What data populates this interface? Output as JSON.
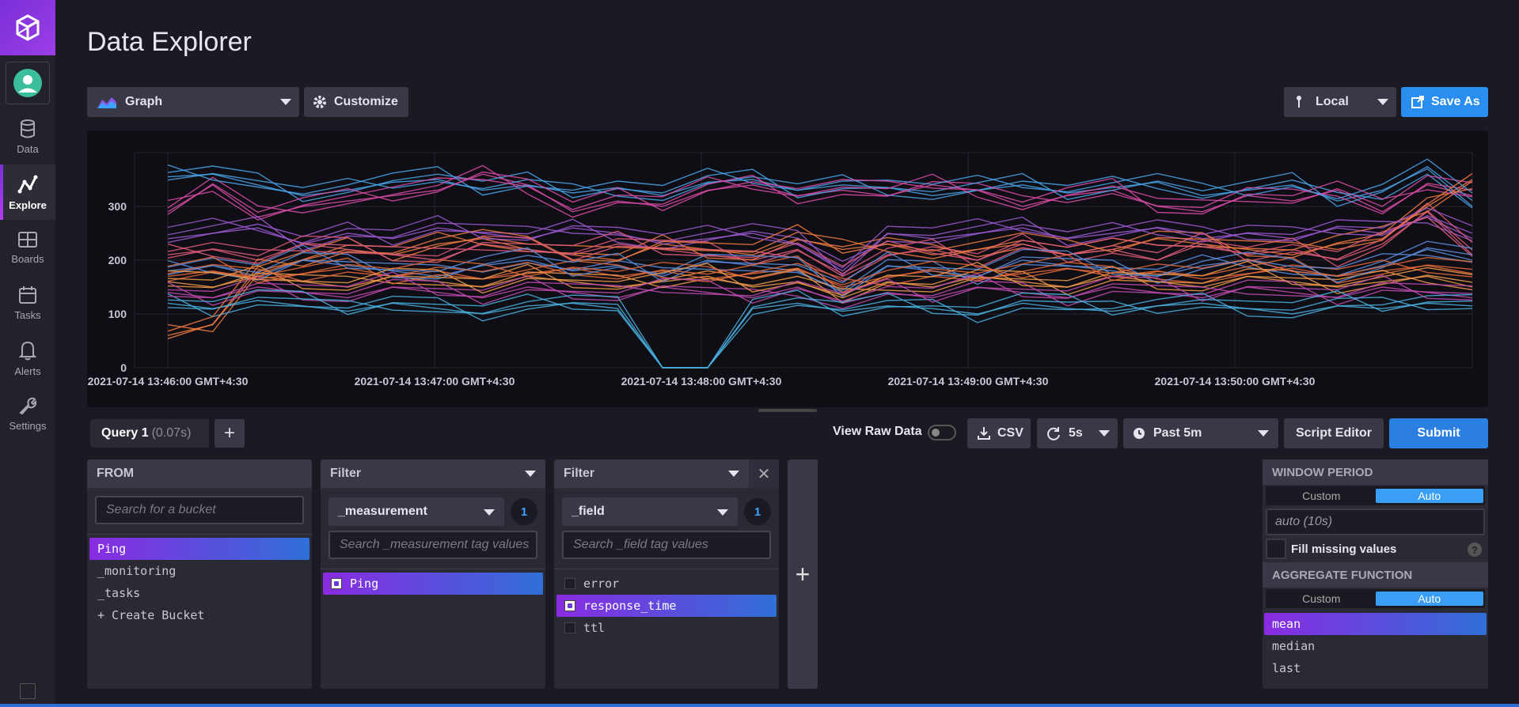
{
  "app": {
    "title": "Data Explorer"
  },
  "sidebar": {
    "items": [
      {
        "label": "Data",
        "icon": "database-icon",
        "active": false
      },
      {
        "label": "Explore",
        "icon": "explore-icon",
        "active": true
      },
      {
        "label": "Boards",
        "icon": "boards-icon",
        "active": false
      },
      {
        "label": "Tasks",
        "icon": "calendar-icon",
        "active": false
      },
      {
        "label": "Alerts",
        "icon": "bell-icon",
        "active": false
      },
      {
        "label": "Settings",
        "icon": "wrench-icon",
        "active": false
      }
    ]
  },
  "toolbar": {
    "graph_type": "Graph",
    "customize_label": "Customize",
    "timezone": "Local",
    "save_as_label": "Save As"
  },
  "colors": {
    "accent_blue": "#2a8ef0",
    "accent_purple": "#8a2be2",
    "line_blue": "#4aa3e8",
    "line_pink": "#d94ba6",
    "line_orange": "#f07a40"
  },
  "chart_data": {
    "type": "line",
    "title": "",
    "xlabel": "",
    "ylabel": "",
    "ylim": [
      0,
      400
    ],
    "y_ticks": [
      "0",
      "100",
      "200",
      "300"
    ],
    "x_ticks": [
      "2021-07-14 13:46:00 GMT+4:30",
      "2021-07-14 13:47:00 GMT+4:30",
      "2021-07-14 13:48:00 GMT+4:30",
      "2021-07-14 13:49:00 GMT+4:30",
      "2021-07-14 13:50:00 GMT+4:30"
    ],
    "grid": true,
    "legend": "none",
    "series_count_estimate": 40,
    "value_range_note_series": [
      {
        "values": [
          355,
          360,
          340,
          320,
          330,
          345,
          350,
          330,
          340,
          325,
          335,
          320,
          345,
          350,
          330,
          340,
          335,
          320,
          330,
          340,
          325,
          335,
          345,
          320,
          330,
          340,
          310,
          330,
          370,
          300
        ]
      },
      {
        "values": [
          290,
          340,
          280,
          300,
          310,
          320,
          330,
          360,
          340,
          290,
          310,
          300,
          330,
          340,
          320,
          330,
          320,
          340,
          330,
          300,
          320,
          330,
          300,
          290,
          320,
          310,
          330,
          290,
          340,
          320
        ]
      },
      {
        "values": [
          60,
          80,
          180,
          200,
          220,
          210,
          230,
          240,
          220,
          210,
          200,
          230,
          220,
          210,
          240,
          220,
          230,
          210,
          220,
          230,
          210,
          220,
          240,
          230,
          220,
          210,
          230,
          240,
          300,
          350
        ]
      },
      {
        "values": [
          240,
          250,
          260,
          230,
          250,
          240,
          260,
          250,
          240,
          260,
          250,
          230,
          240,
          250,
          230,
          180,
          250,
          240,
          250,
          260,
          240,
          250,
          260,
          240,
          250,
          240,
          260,
          250,
          280,
          240
        ]
      },
      {
        "values": [
          210,
          220,
          200,
          230,
          220,
          210,
          200,
          230,
          220,
          210,
          230,
          220,
          210,
          200,
          220,
          170,
          210,
          220,
          200,
          230,
          210,
          220,
          200,
          230,
          210,
          220,
          200,
          230,
          290,
          210
        ]
      },
      {
        "values": [
          180,
          190,
          170,
          200,
          190,
          180,
          170,
          190,
          200,
          180,
          190,
          170,
          200,
          190,
          180,
          140,
          190,
          180,
          170,
          200,
          190,
          180,
          170,
          190,
          200,
          180,
          170,
          190,
          220,
          200
        ]
      },
      {
        "values": [
          160,
          150,
          170,
          160,
          150,
          170,
          160,
          150,
          170,
          160,
          150,
          160,
          170,
          150,
          160,
          130,
          160,
          150,
          170,
          160,
          150,
          170,
          160,
          150,
          170,
          160,
          150,
          160,
          170,
          150
        ]
      },
      {
        "values": [
          140,
          130,
          150,
          140,
          130,
          150,
          140,
          130,
          150,
          140,
          130,
          150,
          140,
          130,
          150,
          120,
          140,
          130,
          150,
          140,
          130,
          150,
          140,
          130,
          150,
          140,
          130,
          150,
          140,
          130
        ]
      },
      {
        "values": [
          120,
          110,
          125,
          115,
          105,
          120,
          110,
          100,
          115,
          120,
          110,
          0,
          0,
          110,
          120,
          105,
          115,
          110,
          100,
          120,
          110,
          105,
          115,
          120,
          110,
          100,
          115,
          110,
          120,
          115
        ]
      },
      {
        "values": [
          170,
          180,
          165,
          175,
          185,
          170,
          180,
          165,
          175,
          185,
          170,
          180,
          165,
          175,
          185,
          150,
          170,
          180,
          165,
          175,
          185,
          170,
          180,
          165,
          175,
          185,
          170,
          180,
          190,
          175
        ]
      }
    ]
  },
  "query": {
    "tab_label": "Query 1",
    "tab_time": "(0.07s)",
    "view_raw_label": "View Raw Data",
    "csv_label": "CSV",
    "refresh_label": "5s",
    "range_label": "Past 5m",
    "script_editor_label": "Script Editor",
    "submit_label": "Submit"
  },
  "builder": {
    "from": {
      "header": "FROM",
      "search_placeholder": "Search for a bucket",
      "items": [
        "Ping",
        "_monitoring",
        "_tasks",
        "+ Create Bucket"
      ],
      "selected": "Ping"
    },
    "filter1": {
      "header": "Filter",
      "key": "_measurement",
      "count": "1",
      "search_placeholder": "Search _measurement tag values",
      "items": [
        "Ping"
      ],
      "selected": "Ping"
    },
    "filter2": {
      "header": "Filter",
      "key": "_field",
      "count": "1",
      "search_placeholder": "Search _field tag values",
      "items": [
        "error",
        "response_time",
        "ttl"
      ],
      "selected": "response_time"
    },
    "add_label": "+"
  },
  "right_panel": {
    "window_period_header": "WINDOW PERIOD",
    "custom_label": "Custom",
    "auto_label": "Auto",
    "period_value": "auto (10s)",
    "fill_missing_label": "Fill missing values",
    "help_label": "?",
    "aggregate_header": "AGGREGATE FUNCTION",
    "aggregates": [
      "mean",
      "median",
      "last"
    ],
    "selected_aggregate": "mean"
  }
}
